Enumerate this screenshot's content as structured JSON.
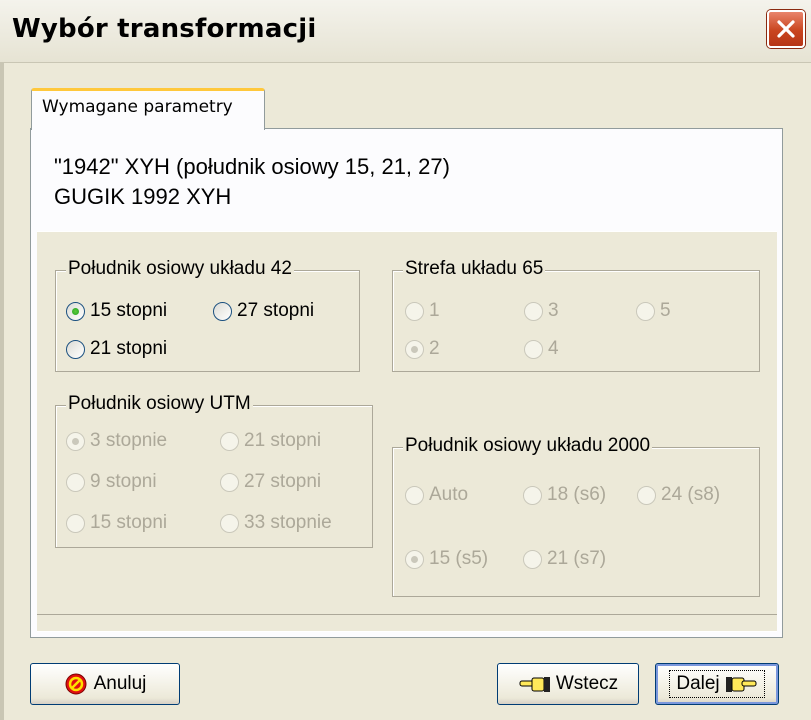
{
  "window": {
    "title": "Wybór transformacji"
  },
  "tabs": [
    {
      "label": "Wymagane parametry",
      "active": true
    }
  ],
  "description": [
    "\"1942\" XYH (południk osiowy 15, 21, 27)",
    "GUGIK 1992 XYH"
  ],
  "groups": {
    "meridian42": {
      "legend": "Południk osiowy układu 42",
      "enabled": true,
      "options": [
        {
          "label": "15 stopni",
          "checked": true
        },
        {
          "label": "27 stopni",
          "checked": false
        },
        {
          "label": "21 stopni",
          "checked": false
        }
      ]
    },
    "zone65": {
      "legend": "Strefa układu 65",
      "enabled": false,
      "options": [
        {
          "label": "1",
          "checked": false
        },
        {
          "label": "3",
          "checked": false
        },
        {
          "label": "5",
          "checked": false
        },
        {
          "label": "2",
          "checked": true
        },
        {
          "label": "4",
          "checked": false
        }
      ]
    },
    "utm": {
      "legend": "Południk osiowy UTM",
      "enabled": false,
      "options": [
        {
          "label": "3 stopnie",
          "checked": true
        },
        {
          "label": "21 stopni",
          "checked": false
        },
        {
          "label": "9 stopni",
          "checked": false
        },
        {
          "label": "27 stopni",
          "checked": false
        },
        {
          "label": "15 stopni",
          "checked": false
        },
        {
          "label": "33 stopnie",
          "checked": false
        }
      ]
    },
    "system2000": {
      "legend": "Południk osiowy układu 2000",
      "enabled": false,
      "options": [
        {
          "label": "Auto",
          "checked": false
        },
        {
          "label": "18 (s6)",
          "checked": false
        },
        {
          "label": "24 (s8)",
          "checked": false
        },
        {
          "label": "15 (s5)",
          "checked": true
        },
        {
          "label": "21 (s7)",
          "checked": false
        }
      ]
    }
  },
  "buttons": {
    "cancel": {
      "label": "Anuluj",
      "icon": "stop-icon"
    },
    "back": {
      "label": "Wstecz",
      "icon": "hand-pointing-left-icon"
    },
    "next": {
      "label": "Dalej",
      "icon": "hand-pointing-right-icon"
    }
  },
  "colors": {
    "accent": "#ffc83c",
    "close": "#c9451f",
    "disabled_text": "#aca899"
  }
}
